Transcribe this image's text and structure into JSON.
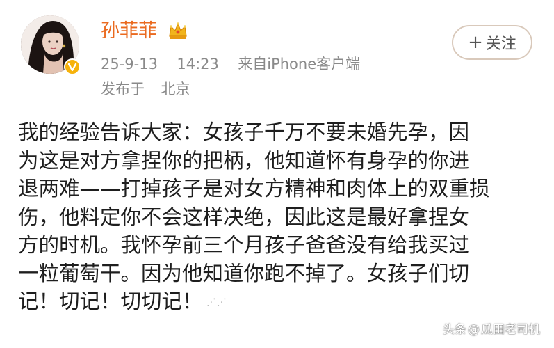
{
  "header": {
    "username": "孙菲菲",
    "date": "25-9-13",
    "time": "14:23",
    "source": "来自iPhone客户端",
    "location_label": "发布于",
    "location": "北京",
    "follow_label": "关注",
    "follow_plus": "+"
  },
  "post": {
    "lines": [
      "我的经验告诉大家：女孩子千万不要未婚先孕，因",
      "为这是对方拿捏你的把柄，他知道怀有身孕的你进",
      "退两难——打掉孩子是对女方精神和肉体上的双重损",
      "伤，他料定你不会这样决绝，因此这是最好拿捏女",
      "方的时机。我怀孕前三个月孩子爸爸没有给我买过",
      "一粒葡萄干。因为他知道你跑不掉了。女孩子们切",
      "记！切记！切切记！"
    ]
  },
  "watermark": {
    "prefix": "头条",
    "at": "@",
    "account": "瓜田老司机"
  },
  "icons": {
    "crown": "crown-icon",
    "verified": "verified-badge-icon",
    "plus": "plus-icon"
  },
  "colors": {
    "username": "#ea6a1f",
    "verified_badge": "#f6b20b",
    "meta_text": "#8a8a8a",
    "body_text": "#1e1e1e"
  }
}
